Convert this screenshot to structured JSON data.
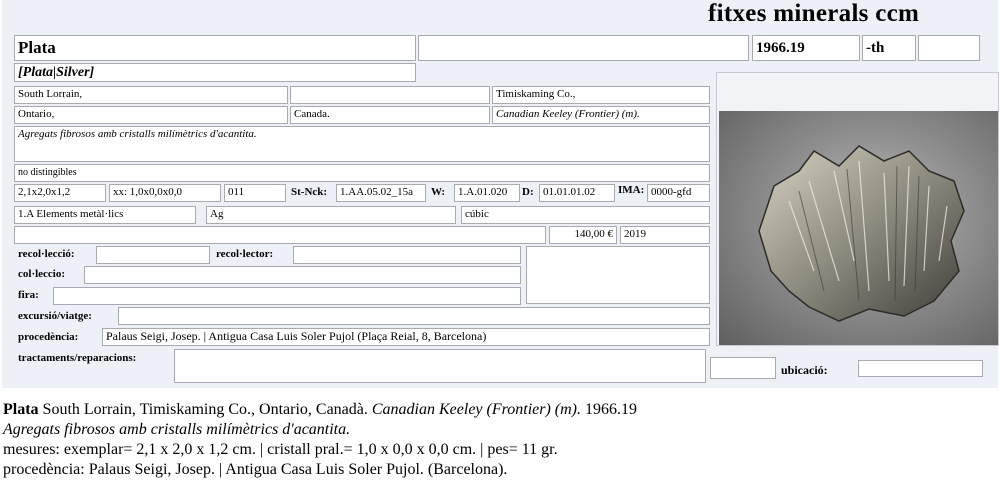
{
  "header": {
    "title": "fitxes minerals ccm"
  },
  "card": {
    "mineral_name": "Plata",
    "name_blank": "",
    "catalog_number": "1966.19",
    "suffix": "-th",
    "suffix_extra": "",
    "synonym": "[Plata|Silver]",
    "locality": {
      "place": "South Lorrain,",
      "place_extra": "",
      "district": "Timiskaming Co.,",
      "province": "Ontario,",
      "country": "Canada.",
      "mine": "Canadian Keeley (Frontier) (m)."
    },
    "description": "Agregats fibrosos amb cristalls milímètrics d'acantita.",
    "associated": "no distingibles",
    "size": "2,1x2,0x1,2",
    "crystal_size": "xx: 1,0x0,0x0,0",
    "weight": "011",
    "strunz_label": "St-Nck:",
    "strunz_code": "1.AA.05.02_15a",
    "w_label": "W:",
    "w_code": "1.A.01.020",
    "d_label": "D:",
    "d_code": "01.01.01.02",
    "ima_label": "IMA:",
    "ima_code": "0000-gfd",
    "class": "1.A Elements metàl·lics",
    "formula": "Ag",
    "system": "cúbic",
    "notes_blank": "",
    "price": "140,00 €",
    "year": "2019"
  },
  "fields": {
    "collection_label": "recol·lecció:",
    "collection_value": "",
    "collector_label": "recol·lector:",
    "collector_value": "",
    "colleccio_label": "col·leccio:",
    "colleccio_value": "",
    "fira_label": "fira:",
    "fira_value": "",
    "trip_label": "excursió/viatge:",
    "trip_value": "",
    "provenance_label": "procedència:",
    "provenance_value": "Palaus Seigi, Josep. | Antigua Casa Luis Soler Pujol (Plaça Reial, 8, Barcelona)",
    "treatments_label": "tractaments/reparacions:",
    "treatments_value": "",
    "location_label": "ubicació:",
    "location_value": "",
    "side_value": ""
  },
  "caption": {
    "name": "Plata",
    "locality": " South Lorrain, Timiskaming Co., Ontario, Canadà. ",
    "mine": "Canadian Keeley (Frontier) (m).",
    "number": " 1966.19",
    "description": "Agregats fibrosos amb cristalls milímètrics d'acantita.",
    "measures": "mesures: exemplar= 2,1 x 2,0 x 1,2 cm. | cristall pral.= 1,0 x 0,0 x 0,0 cm. | pes= 11 gr.",
    "provenance": "procedència: Palaus Seigi, Josep. | Antigua Casa Luis Soler Pujol. (Barcelona)."
  },
  "photo": {
    "icon": "mineral-specimen-photo",
    "background": "#8f8f8f",
    "specimen_color": "#b8b4a6"
  }
}
